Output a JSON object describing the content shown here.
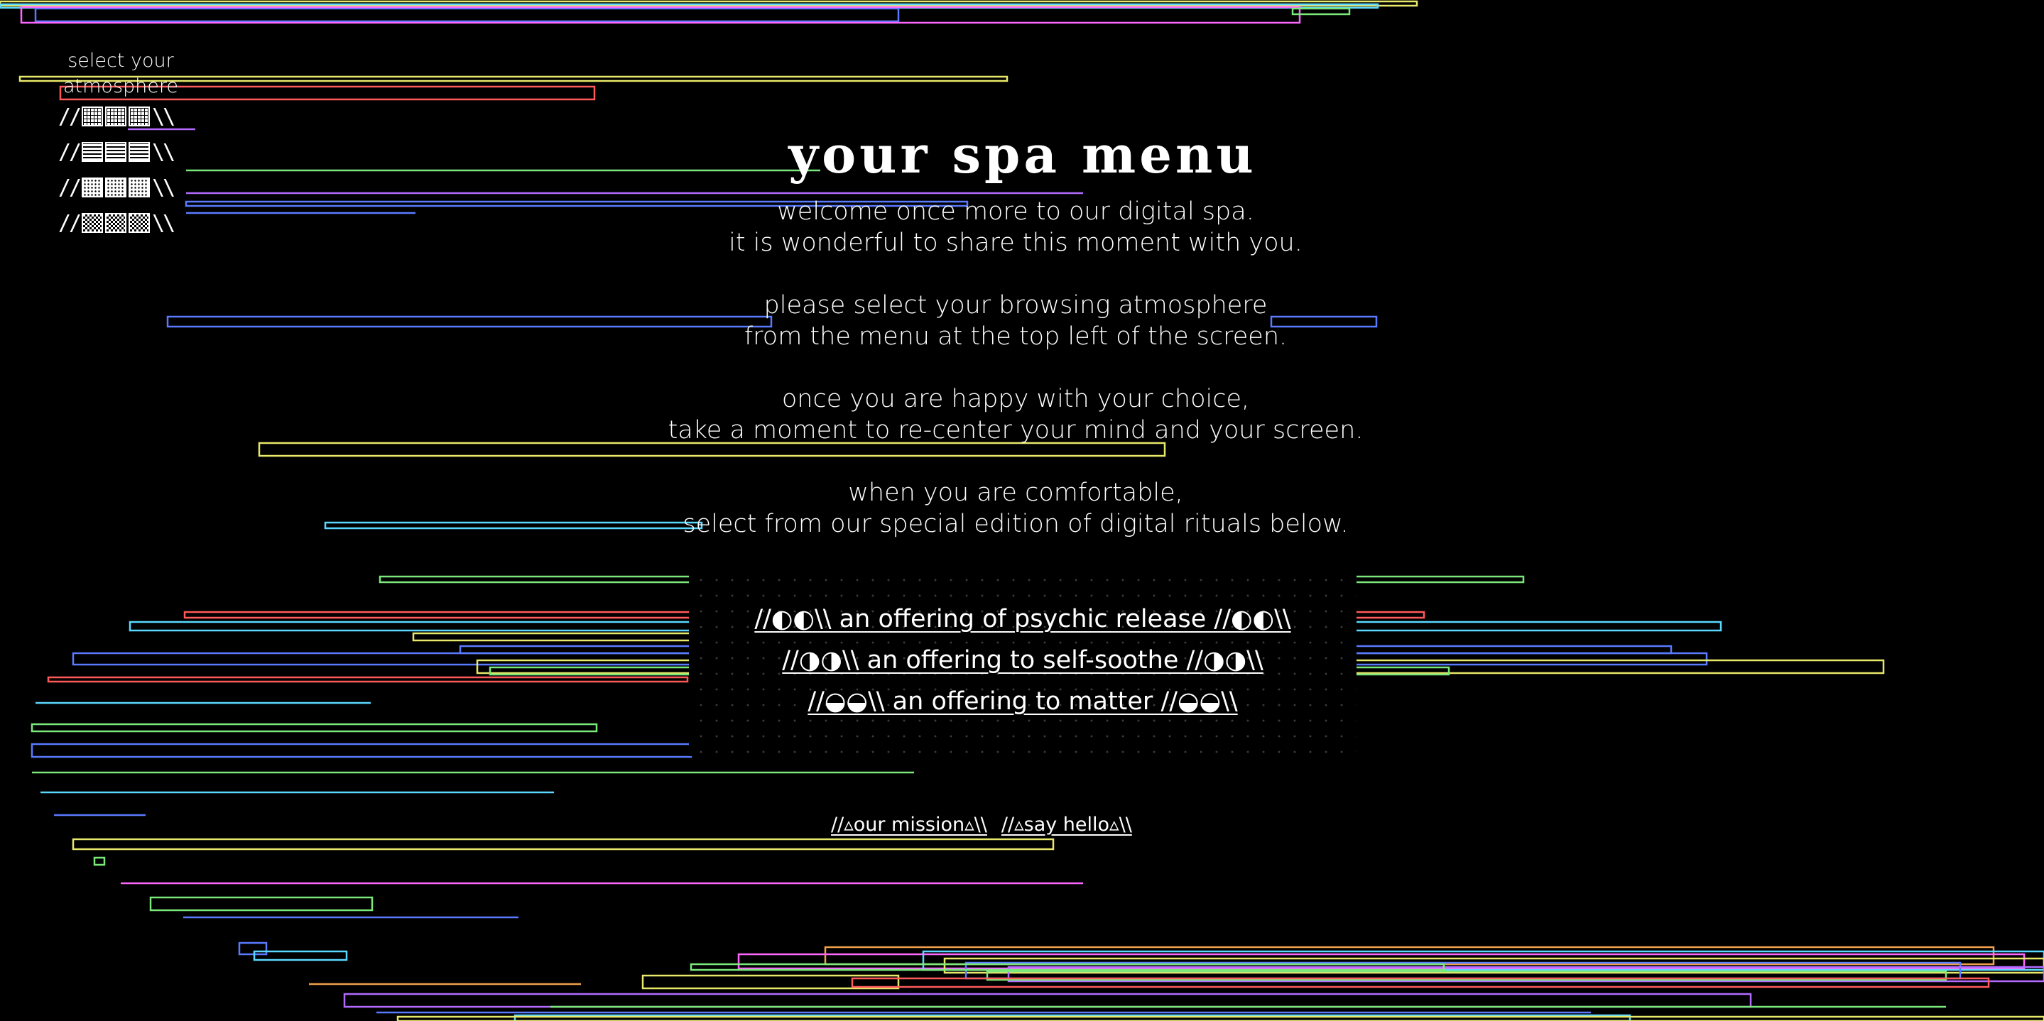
{
  "atmosphere_menu": {
    "label_line1": "select your",
    "label_line2": "atmosphere",
    "items": [
      {
        "prefix": "//",
        "suffix": "\\\\",
        "pattern": "grid"
      },
      {
        "prefix": "//",
        "suffix": "\\\\",
        "pattern": "horizontal-lines"
      },
      {
        "prefix": "//",
        "suffix": "\\\\",
        "pattern": "dots"
      },
      {
        "prefix": "//",
        "suffix": "\\\\",
        "pattern": "checker"
      }
    ]
  },
  "title": "your spa menu",
  "intro": {
    "p1_line1": "welcome once more to our digital spa.",
    "p1_line2": "it is wonderful to share this moment with you.",
    "p2_line1": "please select your browsing atmosphere",
    "p2_line2": "from the menu at the top left of the screen.",
    "p3_line1": "once you are happy with your choice,",
    "p3_line2": "take a moment to re-center your mind and your screen.",
    "p4_line1": "when you are comfortable,",
    "p4_line2": "select from our special edition of digital rituals below."
  },
  "rituals": [
    {
      "label": "//◐◐\\\\ an offering of psychic release //◐◐\\\\"
    },
    {
      "label": "//◑◑\\\\ an offering to self-soothe //◑◑\\\\"
    },
    {
      "label": "//◒◒\\\\ an offering to matter //◒◒\\\\"
    }
  ],
  "footer": {
    "mission": "//▵our mission▵\\\\",
    "hello": "//▵say hello▵\\\\"
  },
  "colors": {
    "background": "#000000",
    "text": "#ffffff",
    "glitch_lines": [
      "#e8e86a",
      "#ff5a5a",
      "#7ae87a",
      "#5a7aff",
      "#5ad8ff",
      "#ff66ff",
      "#b36bff",
      "#f0a04b"
    ]
  }
}
